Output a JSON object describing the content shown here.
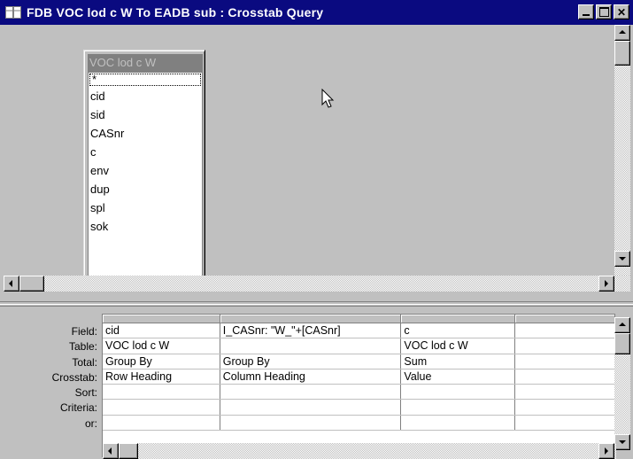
{
  "window": {
    "title": "FDB VOC lod c W To EADB sub : Crosstab Query",
    "icon": "query-grid-icon"
  },
  "field_list": {
    "table_name": "VOC lod c W",
    "fields": [
      "*",
      "cid",
      "sid",
      "CASnr",
      "c",
      "env",
      "dup",
      "spl",
      "sok"
    ]
  },
  "design_grid": {
    "row_labels": [
      "Field:",
      "Table:",
      "Total:",
      "Crosstab:",
      "Sort:",
      "Criteria:",
      "or:"
    ],
    "columns": [
      {
        "field": "cid",
        "table": "VOC lod c W",
        "total": "Group By",
        "crosstab": "Row Heading",
        "sort": "",
        "criteria": "",
        "or": ""
      },
      {
        "field": "I_CASnr: \"W_\"+[CASnr]",
        "table": "",
        "total": "Group By",
        "crosstab": "Column Heading",
        "sort": "",
        "criteria": "",
        "or": ""
      },
      {
        "field": "c",
        "table": "VOC lod c W",
        "total": "Sum",
        "crosstab": "Value",
        "sort": "",
        "criteria": "",
        "or": ""
      },
      {
        "field": "",
        "table": "",
        "total": "",
        "crosstab": "",
        "sort": "",
        "criteria": "",
        "or": ""
      }
    ]
  },
  "colors": {
    "titlebar": "#0a0a80",
    "face": "#c0c0c0",
    "field_list_title": "#808080"
  }
}
